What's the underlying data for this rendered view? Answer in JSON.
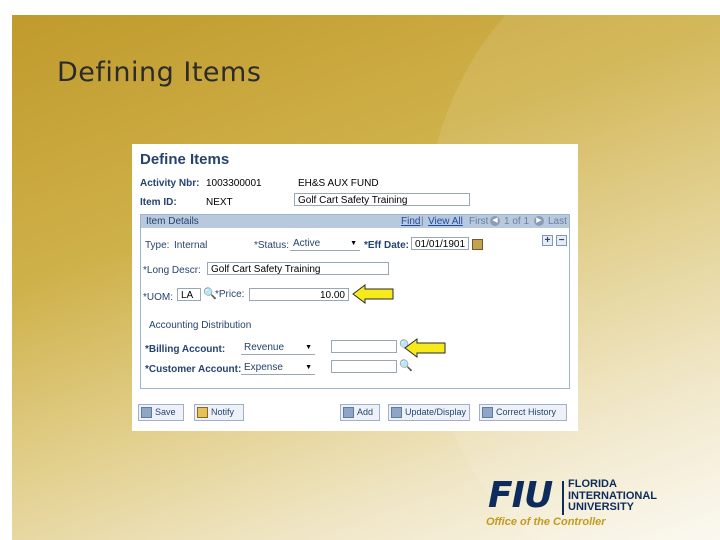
{
  "slide": {
    "title": "Defining Items"
  },
  "form": {
    "page_title": "Define Items",
    "activity_nbr_label": "Activity Nbr:",
    "activity_nbr_value": "1003300001",
    "activity_desc": "EH&S AUX FUND",
    "item_id_label": "Item ID:",
    "item_id_value": "NEXT",
    "item_desc": "Golf Cart Safety Training"
  },
  "item_details": {
    "title": "Item Details",
    "nav": {
      "find": "Find",
      "view_all": "View All",
      "first": "First",
      "counter": "1 of 1",
      "last": "Last"
    },
    "type_label": "Type:",
    "type_value": "Internal",
    "status_label": "*Status:",
    "status_value": "Active",
    "eff_date_label": "*Eff Date:",
    "eff_date_value": "01/01/1901",
    "long_descr_label": "*Long Descr:",
    "long_descr_value": "Golf Cart Safety Training",
    "uom_label": "*UOM:",
    "uom_value": "LA",
    "price_label": "*Price:",
    "price_value": "10.00",
    "accounting": {
      "title": "Accounting Distribution",
      "billing_label": "*Billing Account:",
      "billing_value": "Revenue",
      "customer_label": "*Customer Account:",
      "customer_value": "Expense"
    }
  },
  "toolbar": {
    "save": "Save",
    "notify": "Notify",
    "add": "Add",
    "update_display": "Update/Display",
    "correct_history": "Correct History"
  },
  "logo": {
    "mark": "FIU",
    "line1": "FLORIDA",
    "line2": "INTERNATIONAL",
    "line3": "UNIVERSITY",
    "tagline": "Office of the Controller"
  },
  "colors": {
    "accent_gold": "#c49a1e",
    "ps_label": "#26436e",
    "callout": "#f7ea1a"
  }
}
